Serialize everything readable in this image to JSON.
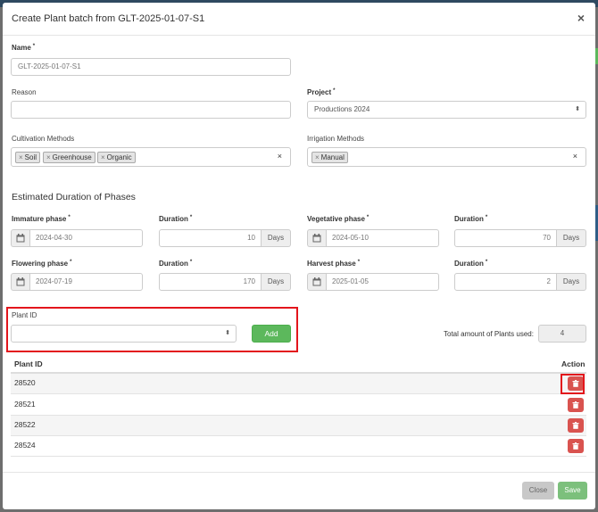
{
  "modal": {
    "title": "Create Plant batch from GLT-2025-01-07-S1",
    "close_glyph": "×"
  },
  "form": {
    "name": {
      "label": "Name",
      "value": "GLT-2025-01-07-S1"
    },
    "reason": {
      "label": "Reason",
      "value": ""
    },
    "project": {
      "label": "Project",
      "value": "Productions 2024"
    },
    "cultivation": {
      "label": "Cultivation Methods",
      "tags": [
        "Soil",
        "Greenhouse",
        "Organic"
      ]
    },
    "irrigation": {
      "label": "Irrigation Methods",
      "tags": [
        "Manual"
      ]
    },
    "tag_remove_glyph": "×",
    "clear_glyph": "×",
    "required_mark": "*"
  },
  "phases": {
    "title": "Estimated Duration of Phases",
    "duration_label": "Duration",
    "unit": "Days",
    "immature": {
      "label": "Immature phase",
      "date": "2024-04-30",
      "duration": "10"
    },
    "vegetative": {
      "label": "Vegetative phase",
      "date": "2024-05-10",
      "duration": "70"
    },
    "flowering": {
      "label": "Flowering phase",
      "date": "2024-07-19",
      "duration": "170"
    },
    "harvest": {
      "label": "Harvest phase",
      "date": "2025-01-05",
      "duration": "2"
    }
  },
  "plant": {
    "label": "Plant ID",
    "add_label": "Add",
    "total_label": "Total amount of Plants used:",
    "total_value": "4"
  },
  "table": {
    "headers": {
      "plant_id": "Plant ID",
      "action": "Action"
    },
    "rows": [
      "28520",
      "28521",
      "28522",
      "28524"
    ]
  },
  "footer": {
    "close_label": "Close",
    "save_label": "Save"
  },
  "colors": {
    "add_green": "#5cb85c",
    "delete_red": "#d9534f",
    "highlight_red": "#e3151c"
  }
}
